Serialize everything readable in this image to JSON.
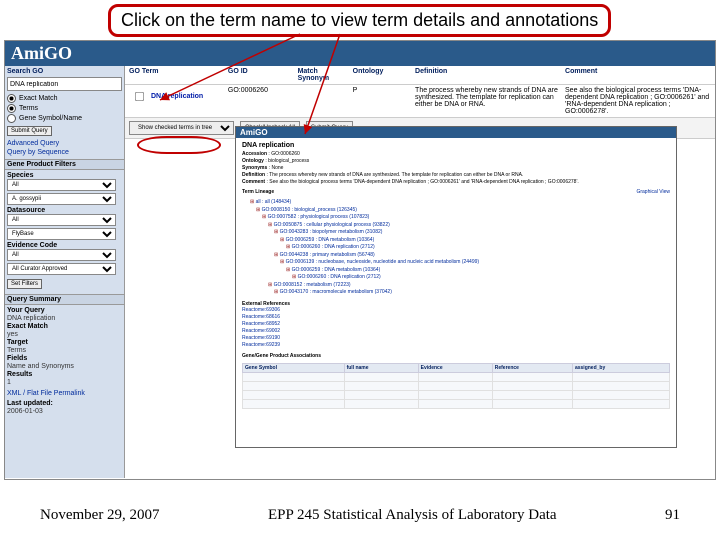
{
  "slide": {
    "callout": "Click on the term name to view term details and annotations",
    "footer_date": "November 29, 2007",
    "footer_title": "EPP 245 Statistical Analysis of Laboratory Data",
    "footer_page": "91"
  },
  "app": {
    "logo": "AmiGO"
  },
  "sidebar": {
    "search_label": "Search GO",
    "search_value": "DNA replication",
    "radio_exact": "Exact Match",
    "radio_terms": "Terms",
    "radio_genes": "Gene Symbol/Name",
    "submit": "Submit Query",
    "links": [
      "Advanced Query",
      "Query by Sequence"
    ],
    "filters_head": "Gene Product Filters",
    "species_label": "Species",
    "species_value": "All",
    "species_opt": "A. gossypii",
    "datasource_label": "Datasource",
    "datasource_value": "All",
    "datasource_opt": "FlyBase",
    "evidence_label": "Evidence Code",
    "evidence_value": "All",
    "evidence_opt": "All Curator Approved",
    "set_filters": "Set Filters",
    "summary_head": "Query Summary",
    "summary": {
      "your_query_label": "Your Query",
      "your_query": "DNA replication",
      "exact_match_label": "Exact Match",
      "exact_match": "yes",
      "target_label": "Target",
      "target": "Terms",
      "fields_label": "Fields",
      "fields": "Name and Synonyms",
      "results_label": "Results",
      "results": "1"
    },
    "permalink_label": "XML / Flat File Permalink",
    "last_updated_label": "Last updated:",
    "last_updated": "2006-01-03"
  },
  "results": {
    "cols": [
      "GO Term",
      "GO ID",
      "Match Synonym",
      "Ontology",
      "Definition",
      "Comment"
    ],
    "row": {
      "term": "DNA replication",
      "goid": "GO:0006260",
      "synonym": "",
      "ontology": "P",
      "definition": "The process whereby new strands of DNA are synthesized. The template for replication can either be DNA or RNA.",
      "comment": "See also the biological process terms 'DNA-dependent DNA replication ; GO:0006261' and 'RNA-dependent DNA replication ; GO:0006278'."
    },
    "toolbar": {
      "show_in_tree": "Show checked terms in tree",
      "check_all": "Check/Uncheck All",
      "submit": "Submit Query"
    }
  },
  "detail": {
    "bar": "AmiGO",
    "title": "DNA replication",
    "accession_label": "Accession",
    "accession": "GO:0006260",
    "ontology_label": "Ontology",
    "ontology": "biological_process",
    "synonyms_label": "Synonyms",
    "synonyms": "None",
    "definition_label": "Definition",
    "definition": "The process whereby new strands of DNA are synthesized. The template for replication can either be DNA or RNA.",
    "comment_label": "Comment",
    "comment": "See also the biological process terms 'DNA-dependent DNA replication ; GO:0006261' and 'RNA-dependent DNA replication ; GO:0006278'.",
    "tree_label": "Term Lineage",
    "tree_toggle": "Graphical View",
    "tree": [
      "all : all (148434)",
      "  GO:0008150 : biological_process (126345)",
      "    GO:0007582 : physiological process (107823)",
      "      GO:0050875 : cellular physiological process (93822)",
      "        GO:0043283 : biopolymer metabolism (31082)",
      "          GO:0006259 : DNA metabolism (10364)",
      "            GO:0006260 : DNA replication (2712)",
      "        GO:0044238 : primary metabolism (56748)",
      "          GO:0006139 : nucleobase, nucleoside, nucleotide and nucleic acid metabolism (24499)",
      "            GO:0006259 : DNA metabolism (10364)",
      "              GO:0006260 : DNA replication (2712)",
      "      GO:0008152 : metabolism (72223)",
      "        GO:0043170 : macromolecule metabolism (37042)"
    ],
    "external_label": "External References",
    "external": [
      "Reactome:69306",
      "Reactome:68616",
      "Reactome:68952",
      "Reactome:69002",
      "Reactome:69190",
      "Reactome:69239"
    ],
    "assoc_head": "Gene/Gene Product Associations",
    "assoc_cols": [
      "Gene Symbol",
      "full name",
      "Evidence",
      "Reference",
      "assigned_by"
    ]
  }
}
